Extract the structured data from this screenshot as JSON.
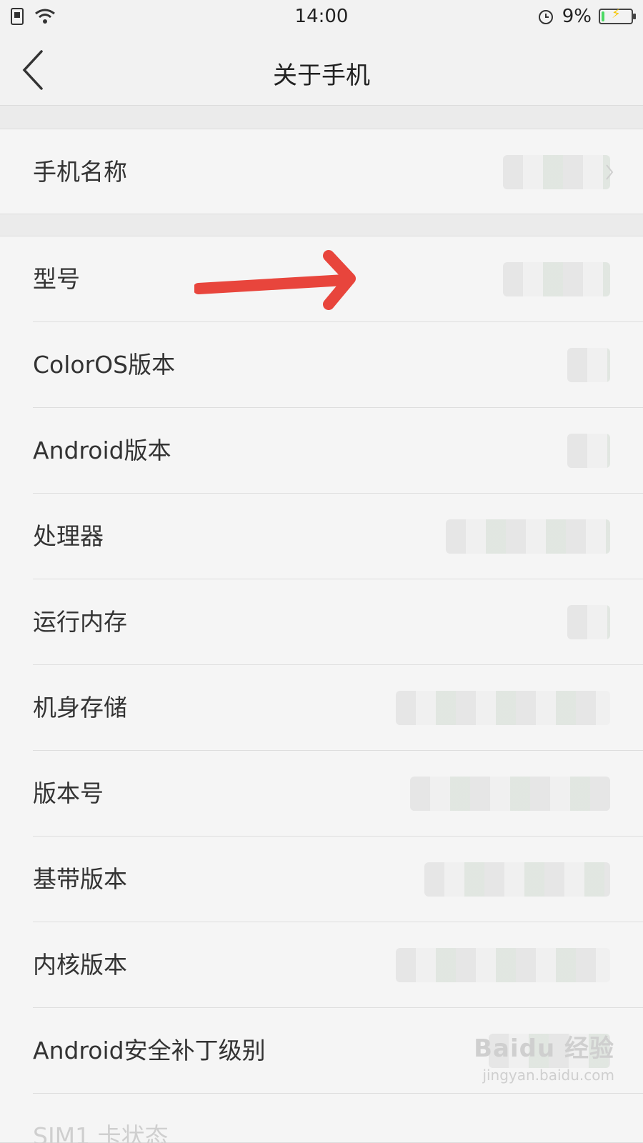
{
  "status_bar": {
    "time": "14:00",
    "battery_percent": "9%",
    "battery_level": 0.09
  },
  "header": {
    "title": "关于手机"
  },
  "groups": [
    {
      "items": [
        {
          "label": "手机名称"
        }
      ]
    },
    {
      "items": [
        {
          "label": "型号"
        },
        {
          "label": "ColorOS版本"
        },
        {
          "label": "Android版本"
        },
        {
          "label": "处理器"
        },
        {
          "label": "运行内存"
        },
        {
          "label": "机身存储"
        },
        {
          "label": "版本号"
        },
        {
          "label": "基带版本"
        },
        {
          "label": "内核版本"
        },
        {
          "label": "Android安全补丁级别"
        },
        {
          "label": "SIM1 卡状态"
        }
      ]
    }
  ],
  "icons": [
    "sim-icon",
    "wifi-icon",
    "alarm-icon",
    "battery-icon",
    "back-icon",
    "chevron-right-icon"
  ],
  "annotation": {
    "color": "#e8453c"
  },
  "watermark": {
    "brand": "Baidu 经验",
    "url": "jingyan.baidu.com"
  }
}
